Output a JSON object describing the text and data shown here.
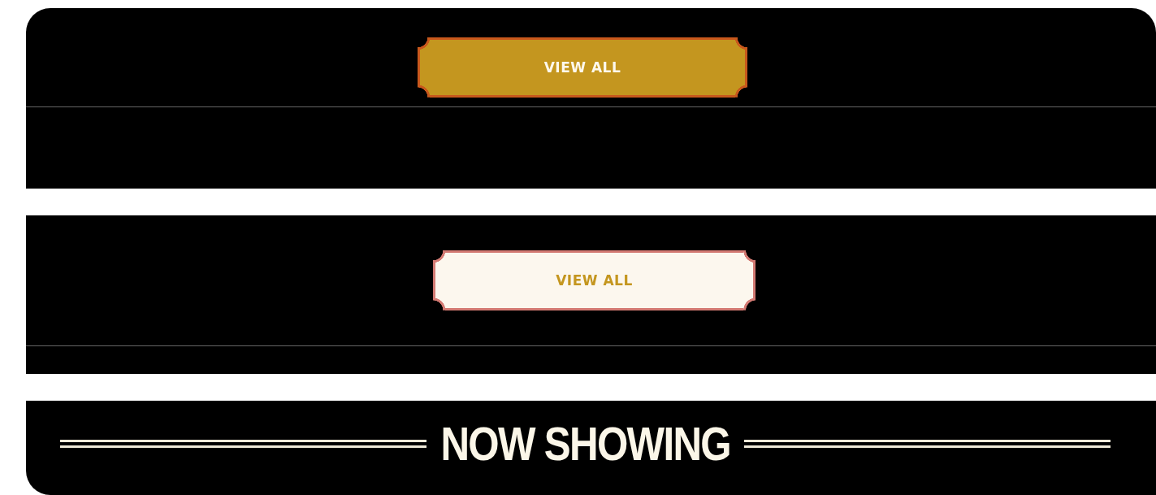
{
  "sections": [
    {
      "kind": "button",
      "button": {
        "label": "VIEW ALL",
        "kind": "primary"
      }
    },
    {
      "kind": "button",
      "button": {
        "label": "VIEW ALL",
        "kind": "secondary"
      }
    },
    {
      "kind": "heading",
      "heading": "NOW SHOWING"
    }
  ]
}
